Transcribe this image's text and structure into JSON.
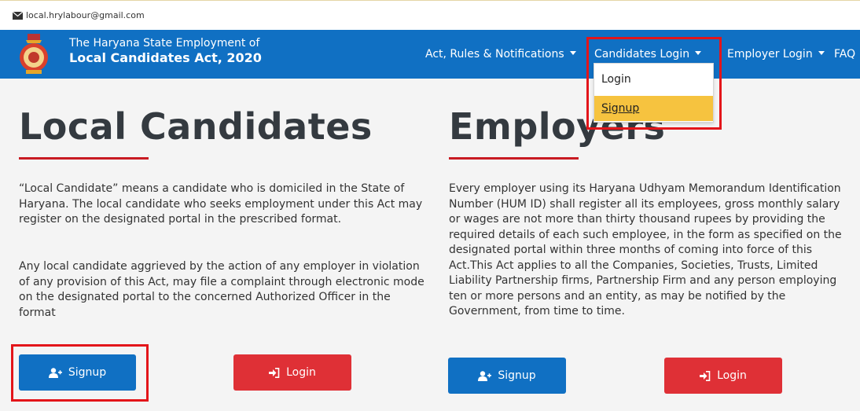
{
  "topbar": {
    "email": "local.hrylabour@gmail.com",
    "icon": "envelope-icon"
  },
  "brand": {
    "line1": "The Haryana State Employment of",
    "line2": "Local Candidates Act, 2020",
    "logo_icon": "state-emblem-icon"
  },
  "nav": {
    "acts": "Act, Rules & Notifications",
    "candidates": "Candidates Login",
    "employer": "Employer Login",
    "faq": "FAQ"
  },
  "dropdown": {
    "login": "Login",
    "signup": "Signup"
  },
  "candidates": {
    "title": "Local Candidates",
    "para1": "“Local Candidate” means a candidate who is domiciled in the State of Haryana. The local candidate who seeks employment under this Act may register on the designated portal in the prescribed format.",
    "para2": "Any local candidate aggrieved by the action of any employer in violation of any provision of this Act, may file a complaint through electronic mode on the designated portal to the concerned Authorized Officer in the format",
    "signup": "Signup",
    "login": "Login"
  },
  "employers": {
    "title": "Employers",
    "para1": "Every employer using its Haryana Udhyam Memorandum Identification Number (HUM ID) shall register all its employees, gross monthly salary or wages are not more than thirty thousand rupees by providing the required details of each such employee, in the form as specified on the designated portal within three months of coming into force of this Act.This Act applies to all the Companies, Societies, Trusts, Limited Liability Partnership firms, Partnership Firm and any person employing ten or more persons and an entity, as may be notified by the Government, from time to time.",
    "signup": "Signup",
    "login": "Login"
  },
  "colors": {
    "nav_blue": "#1070c3",
    "accent_red": "#c81b22",
    "highlight_yellow": "#f6c33f",
    "button_red": "#df3036"
  }
}
